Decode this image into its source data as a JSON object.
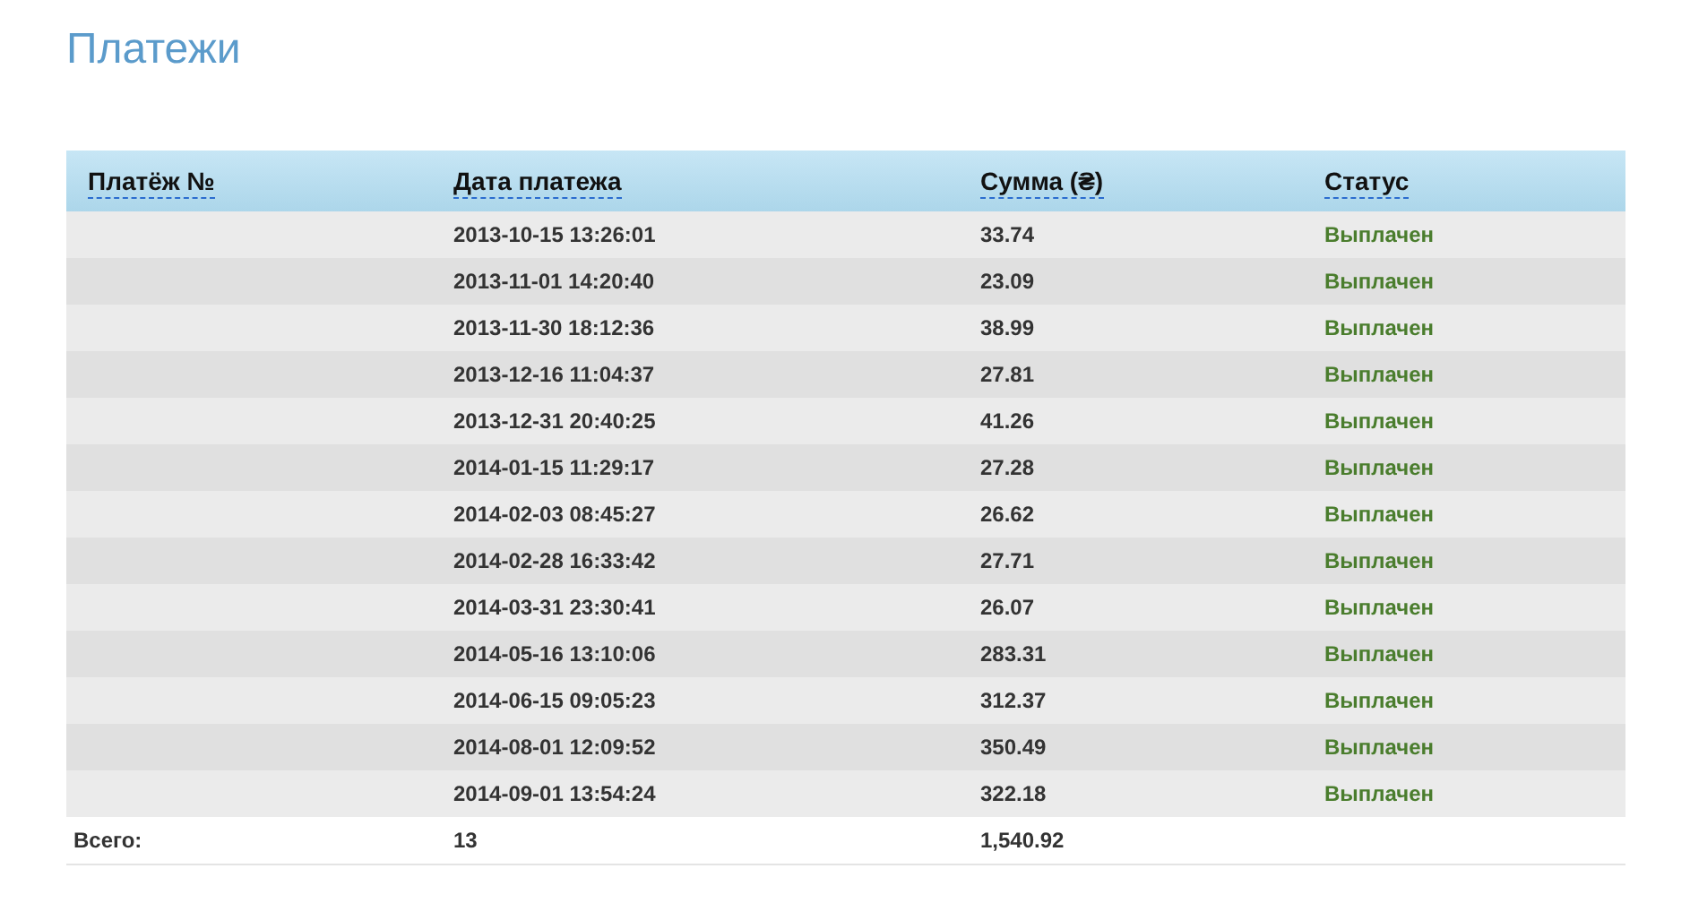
{
  "title": "Платежи",
  "table": {
    "columns": [
      "Платёж №",
      "Дата платежа",
      "Сумма (₴)",
      "Статус"
    ],
    "rows": [
      {
        "date": "2013-10-15 13:26:01",
        "amount": "33.74",
        "status": "Выплачен"
      },
      {
        "date": "2013-11-01 14:20:40",
        "amount": "23.09",
        "status": "Выплачен"
      },
      {
        "date": "2013-11-30 18:12:36",
        "amount": "38.99",
        "status": "Выплачен"
      },
      {
        "date": "2013-12-16 11:04:37",
        "amount": "27.81",
        "status": "Выплачен"
      },
      {
        "date": "2013-12-31 20:40:25",
        "amount": "41.26",
        "status": "Выплачен"
      },
      {
        "date": "2014-01-15 11:29:17",
        "amount": "27.28",
        "status": "Выплачен"
      },
      {
        "date": "2014-02-03 08:45:27",
        "amount": "26.62",
        "status": "Выплачен"
      },
      {
        "date": "2014-02-28 16:33:42",
        "amount": "27.71",
        "status": "Выплачен"
      },
      {
        "date": "2014-03-31 23:30:41",
        "amount": "26.07",
        "status": "Выплачен"
      },
      {
        "date": "2014-05-16 13:10:06",
        "amount": "283.31",
        "status": "Выплачен"
      },
      {
        "date": "2014-06-15 09:05:23",
        "amount": "312.37",
        "status": "Выплачен"
      },
      {
        "date": "2014-08-01 12:09:52",
        "amount": "350.49",
        "status": "Выплачен"
      },
      {
        "date": "2014-09-01 13:54:24",
        "amount": "322.18",
        "status": "Выплачен"
      }
    ],
    "total": {
      "label": "Всего:",
      "count": "13",
      "amount": "1,540.92"
    }
  }
}
